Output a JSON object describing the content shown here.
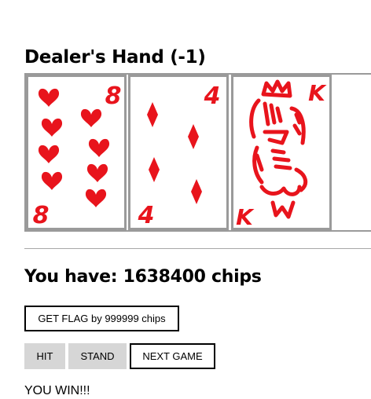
{
  "dealer": {
    "title": "Dealer's Hand (-1)",
    "cards": [
      {
        "rank": "8",
        "suit": "hearts",
        "icon": "heart-icon"
      },
      {
        "rank": "4",
        "suit": "diamonds",
        "icon": "diamond-icon"
      },
      {
        "rank": "K",
        "suit": "king-face",
        "icon": "king-figure-icon"
      }
    ]
  },
  "player": {
    "chips_text": "You have: 1638400 chips"
  },
  "buttons": {
    "flag": "GET FLAG by 999999 chips",
    "hit": "HIT",
    "stand": "STAND",
    "next": "NEXT GAME"
  },
  "result": "YOU WIN!!!",
  "colors": {
    "suit_red": "#e8141c",
    "card_border": "#9a9a9a",
    "button_gray": "#d6d6d6"
  }
}
